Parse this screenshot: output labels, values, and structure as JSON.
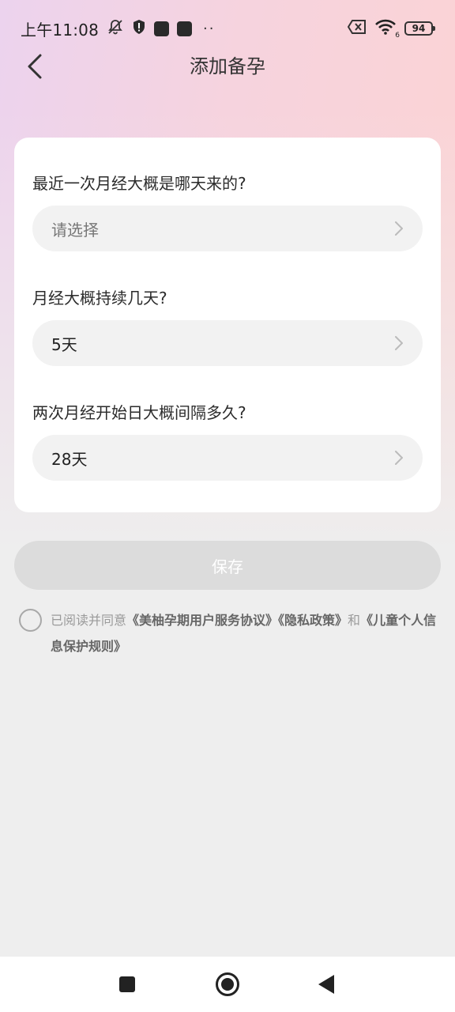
{
  "status_bar": {
    "time": "上午11:08",
    "battery": "94",
    "network_badge": "6",
    "icons": [
      "bell-off-icon",
      "shield-alert-icon",
      "app-square-icon",
      "app-square-icon",
      "more-dots-icon",
      "sim-error-icon",
      "wifi-icon",
      "battery-icon"
    ]
  },
  "header": {
    "title": "添加备孕",
    "back_icon": "chevron-left-icon"
  },
  "form": {
    "last_period": {
      "question": "最近一次月经大概是哪天来的?",
      "placeholder": "请选择"
    },
    "period_length": {
      "question": "月经大概持续几天?",
      "value": "5天"
    },
    "cycle_length": {
      "question": "两次月经开始日大概间隔多久?",
      "value": "28天"
    }
  },
  "save": {
    "label": "保存"
  },
  "agreement": {
    "prefix": "已阅读并同意",
    "link1": "《美柚孕期用户服务协议》",
    "link2": "《隐私政策》",
    "conj": "和",
    "link3": "《儿童个人信息保护规则》"
  },
  "colors": {
    "gradient_left": "#ecd3ee",
    "gradient_right": "#fcd3d3",
    "background": "#eeeeee",
    "card": "#ffffff",
    "save_disabled": "#dcdcdc"
  }
}
